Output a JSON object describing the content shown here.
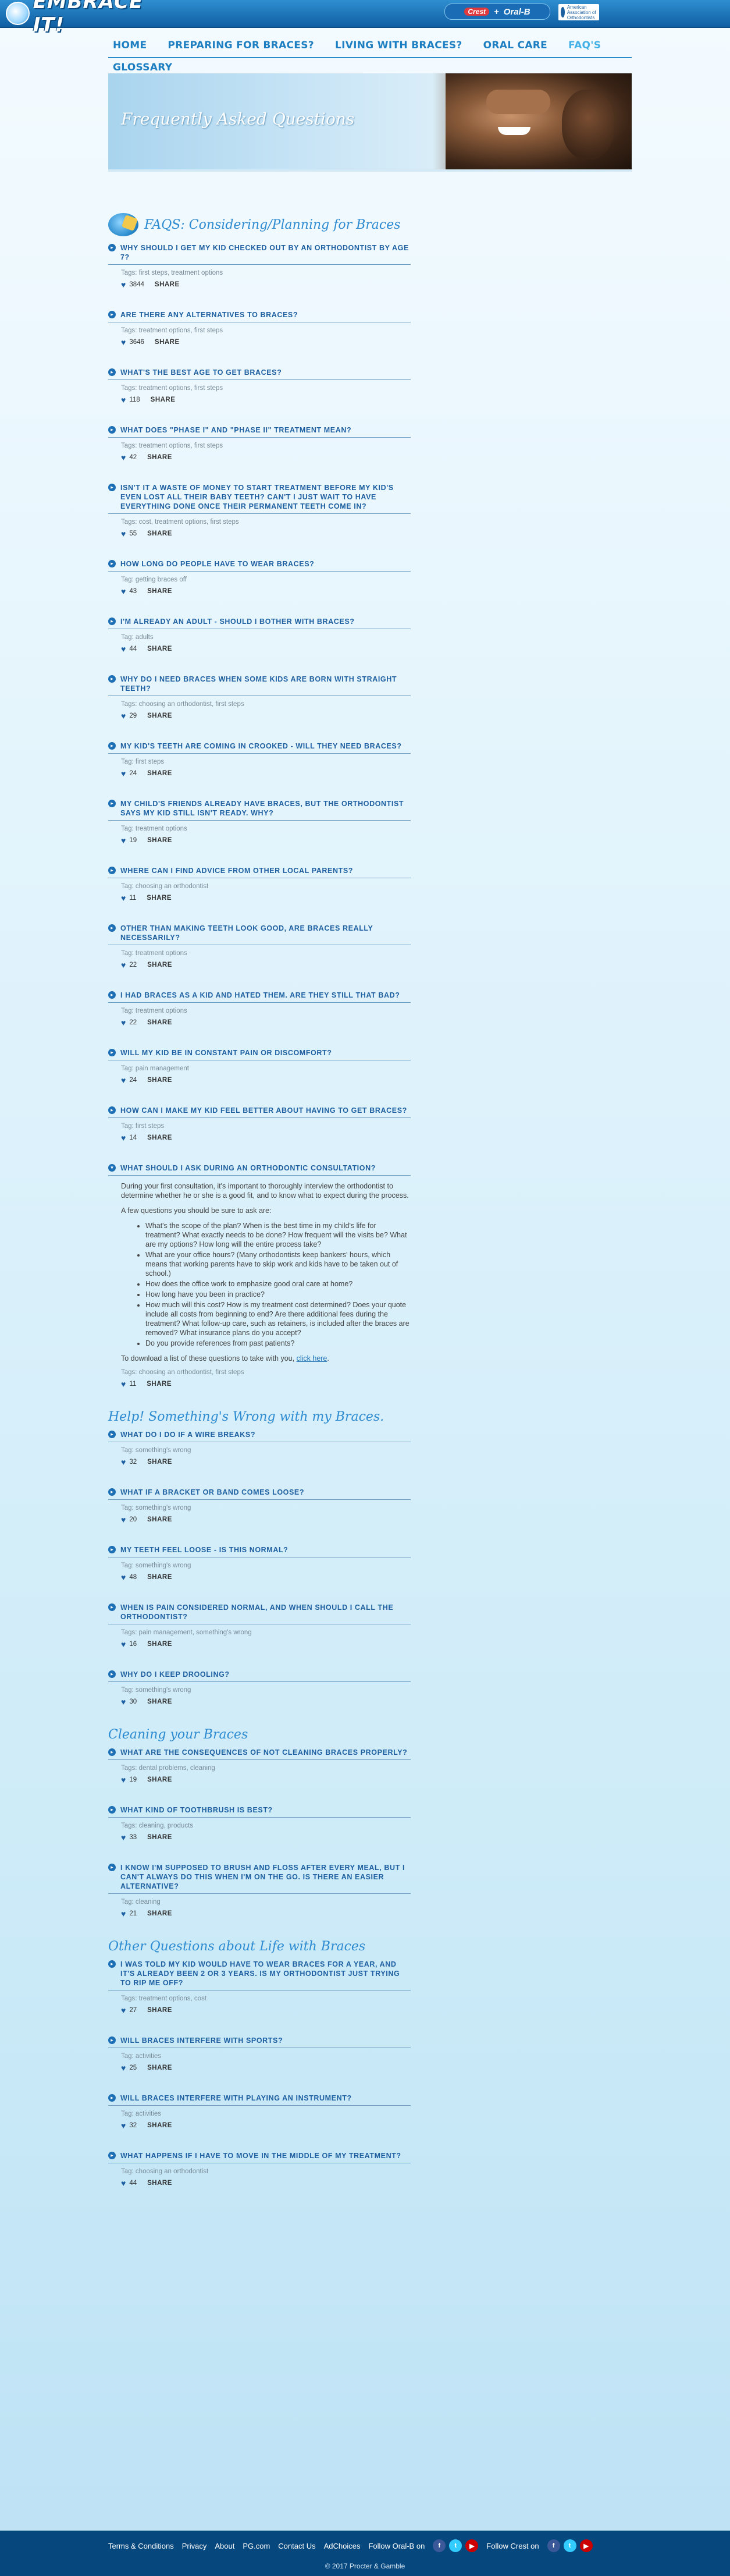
{
  "header": {
    "logo_text": "EMBRACE IT!",
    "brand_crest": "Crest",
    "brand_plus": "+",
    "brand_oralb": "Oral-B",
    "ada_text": "American Association of Orthodontists"
  },
  "nav": {
    "items": [
      "HOME",
      "PREPARING FOR BRACES?",
      "LIVING WITH BRACES?",
      "ORAL CARE",
      "FAQ'S"
    ],
    "glossary": "GLOSSARY"
  },
  "hero": {
    "title": "Frequently Asked Questions"
  },
  "sections": [
    {
      "title": "FAQS: Considering/Planning for Braces",
      "faqs": [
        {
          "q": "Why should I get my kid checked out by an orthodontist by age 7?",
          "tags": "Tags: first steps, treatment options",
          "count": "3844",
          "share": "SHARE"
        },
        {
          "q": "Are there any alternatives to braces?",
          "tags": "Tags: treatment options, first steps",
          "count": "3646",
          "share": "SHARE"
        },
        {
          "q": "What's the best age to get braces?",
          "tags": "Tags: treatment options, first steps",
          "count": "118",
          "share": "SHARE"
        },
        {
          "q": "What does \"Phase I\" and \"Phase II\" treatment mean?",
          "tags": "Tags: treatment options, first steps",
          "count": "42",
          "share": "SHARE"
        },
        {
          "q": "Isn't it a waste of money to start treatment before my kid's even lost all their baby teeth? Can't I just wait to have everything done once their permanent teeth come in?",
          "tags": "Tags: cost, treatment options, first steps",
          "count": "55",
          "share": "SHARE"
        },
        {
          "q": "How long do people have to wear braces?",
          "tags": "Tag: getting braces off",
          "count": "43",
          "share": "SHARE"
        },
        {
          "q": "I'm already an adult - should I bother with braces?",
          "tags": "Tag: adults",
          "count": "44",
          "share": "SHARE"
        },
        {
          "q": "Why do I need braces when some kids are born with straight teeth?",
          "tags": "Tags: choosing an orthodontist, first steps",
          "count": "29",
          "share": "SHARE"
        },
        {
          "q": "My kid's teeth are coming in crooked - will they need braces?",
          "tags": "Tag: first steps",
          "count": "24",
          "share": "SHARE"
        },
        {
          "q": "My child's friends already have braces, but the orthodontist says my kid still isn't ready. Why?",
          "tags": "Tag: treatment options",
          "count": "19",
          "share": "SHARE"
        },
        {
          "q": "Where can I find advice from other local parents?",
          "tags": "Tag: choosing an orthodontist",
          "count": "11",
          "share": "SHARE"
        },
        {
          "q": "Other than making teeth look good, are braces really necessarily?",
          "tags": "Tag: treatment options",
          "count": "22",
          "share": "SHARE"
        },
        {
          "q": "I had braces as a kid and hated them. Are they still that bad?",
          "tags": "Tag: treatment options",
          "count": "22",
          "share": "SHARE"
        },
        {
          "q": "Will my kid be in constant pain or discomfort?",
          "tags": "Tag: pain management",
          "count": "24",
          "share": "SHARE"
        },
        {
          "q": "How can I make my kid feel better about having to get braces?",
          "tags": "Tag: first steps",
          "count": "14",
          "share": "SHARE"
        },
        {
          "q": "What should I ask during an orthodontic consultation?",
          "tags": "Tags: choosing an orthodontist, first steps",
          "count": "11",
          "share": "SHARE",
          "answer": {
            "p1": "During your first consultation, it's important to thoroughly interview the orthodontist to determine whether he or she is a good fit, and to know what to expect during the process.",
            "p2": "A few questions you should be sure to ask are:",
            "bullets": [
              "What's the scope of the plan? When is the best time in my child's life for treatment? What exactly needs to be done? How frequent will the visits be? What are my options? How long will the entire process take?",
              "What are your office hours? (Many orthodontists keep bankers' hours, which means that working parents have to skip work and kids have to be taken out of school.)",
              "How does the office work to emphasize good oral care at home?",
              "How long have you been in practice?",
              "How much will this cost? How is my treatment cost determined? Does your quote include all costs from beginning to end? Are there additional fees during the treatment? What follow-up care, such as retainers, is included after the braces are removed? What insurance plans do you accept?",
              "Do you provide references from past patients?"
            ],
            "p3": "To download a list of these questions to take with you,",
            "link": "click here",
            "p3_end": "."
          }
        }
      ]
    },
    {
      "title": "Help! Something's Wrong with my Braces.",
      "faqs": [
        {
          "q": "What do I do if a wire breaks?",
          "tags": "Tag: something's wrong",
          "count": "32",
          "share": "SHARE"
        },
        {
          "q": "What if a bracket or band comes loose?",
          "tags": "Tag: something's wrong",
          "count": "20",
          "share": "SHARE"
        },
        {
          "q": "My teeth feel loose - is this normal?",
          "tags": "Tag: something's wrong",
          "count": "48",
          "share": "SHARE"
        },
        {
          "q": "When is pain considered normal, and when should I call the orthodontist?",
          "tags": "Tags: pain management, something's wrong",
          "count": "16",
          "share": "SHARE"
        },
        {
          "q": "Why do I keep drooling?",
          "tags": "Tag: something's wrong",
          "count": "30",
          "share": "SHARE"
        }
      ]
    },
    {
      "title": "Cleaning your Braces",
      "faqs": [
        {
          "q": "What are the consequences of not cleaning braces properly?",
          "tags": "Tags: dental problems, cleaning",
          "count": "19",
          "share": "SHARE"
        },
        {
          "q": "What kind of toothbrush is best?",
          "tags": "Tags: cleaning, products",
          "count": "33",
          "share": "SHARE"
        },
        {
          "q": "I know I'm supposed to brush and floss after every meal, but I can't always do this when I'm on the go. Is there an easier alternative?",
          "tags": "Tag: cleaning",
          "count": "21",
          "share": "SHARE"
        }
      ]
    },
    {
      "title": "Other Questions about Life with Braces",
      "faqs": [
        {
          "q": "I was told my kid would have to wear braces for a year, and it's already been 2 or 3 years. Is my orthodontist just trying to rip me off?",
          "tags": "Tags: treatment options, cost",
          "count": "27",
          "share": "SHARE"
        },
        {
          "q": "Will braces interfere with sports?",
          "tags": "Tag: activities",
          "count": "25",
          "share": "SHARE"
        },
        {
          "q": "Will braces interfere with playing an instrument?",
          "tags": "Tag: activities",
          "count": "32",
          "share": "SHARE"
        },
        {
          "q": "What happens if I have to move in the middle of my treatment?",
          "tags": "Tag: choosing an orthodontist",
          "count": "44",
          "share": "SHARE"
        }
      ]
    }
  ],
  "footer": {
    "links": [
      "Terms & Conditions",
      "Privacy",
      "About",
      "PG.com",
      "Contact Us",
      "AdChoices"
    ],
    "follow_oralb": "Follow Oral-B on",
    "follow_crest": "Follow Crest on",
    "copyright": "© 2017 Procter & Gamble"
  },
  "colors": {
    "primary": "#1d5fa0",
    "accent": "#43b0e6",
    "footer_bg": "#06477d"
  }
}
